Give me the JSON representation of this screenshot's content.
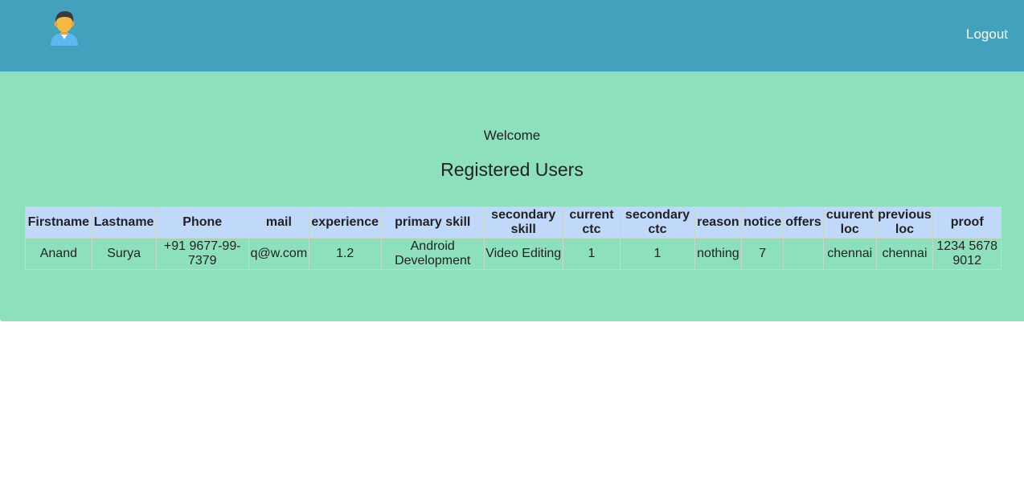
{
  "header": {
    "avatar_icon": "user-avatar-icon",
    "logout_label": "Logout"
  },
  "main": {
    "welcome": "Welcome",
    "title": "Registered Users"
  },
  "table": {
    "columns": [
      "Firstname",
      "Lastname",
      "Phone",
      "mail",
      "experience",
      "primary skill",
      "secondary skill",
      "current ctc",
      "secondary ctc",
      "reason",
      "notice",
      "offers",
      "cuurent loc",
      "previous loc",
      "proof"
    ],
    "rows": [
      [
        "Anand",
        "Surya",
        "+91 9677-99-7379",
        "q@w.com",
        "1.2",
        "Android Development",
        "Video Editing",
        "1",
        "1",
        "nothing",
        "7",
        "",
        "chennai",
        "chennai",
        "1234 5678 9012"
      ]
    ]
  },
  "colors": {
    "header_bg": "#42a1bc",
    "panel_bg": "#8ce0bb",
    "table_header_bg": "#c0d8fa"
  }
}
